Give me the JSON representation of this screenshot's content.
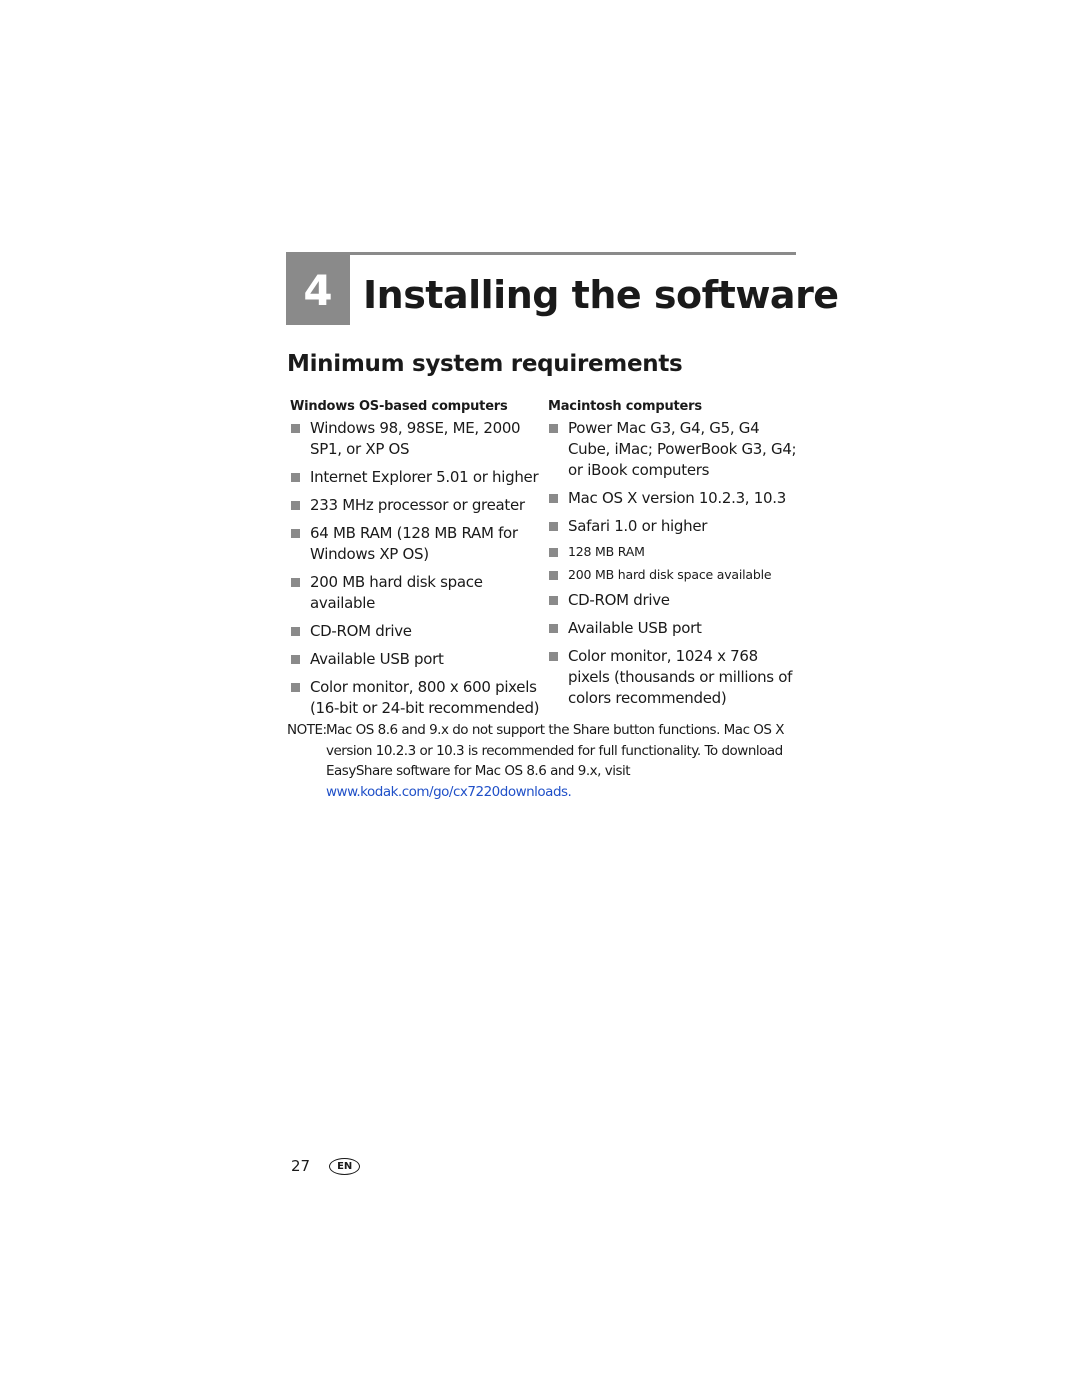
{
  "chapter": {
    "number": "4",
    "title": "Installing the software"
  },
  "section": {
    "title": "Minimum system requirements"
  },
  "windows": {
    "heading": "Windows OS-based computers",
    "items": [
      "Windows 98, 98SE, ME, 2000 SP1, or XP OS",
      "Internet Explorer 5.01 or higher",
      "233 MHz processor or greater",
      "64 MB RAM (128 MB RAM for Windows XP OS)",
      "200 MB hard disk space available",
      "CD-ROM drive",
      "Available USB port",
      "Color monitor, 800 x 600 pixels (16-bit or 24-bit recommended)"
    ]
  },
  "mac": {
    "heading": "Macintosh computers",
    "items": [
      "Power Mac G3, G4, G5, G4 Cube, iMac; PowerBook G3, G4; or iBook computers",
      "Mac OS X version 10.2.3, 10.3",
      "Safari 1.0 or higher",
      "128 MB RAM",
      "200 MB hard disk space available",
      "CD-ROM drive",
      "Available USB port",
      "Color monitor, 1024 x 768 pixels (thousands or millions of colors recommended)"
    ]
  },
  "note": {
    "label": "NOTE:",
    "text": "Mac OS 8.6 and 9.x do not support the Share button functions. Mac OS X version 10.2.3 or 10.3 is recommended for full functionality. To download EasyShare software for Mac OS 8.6 and 9.x, visit ",
    "link": "www.kodak.com/go/cx7220downloads."
  },
  "footer": {
    "page_number": "27",
    "language": "EN"
  }
}
